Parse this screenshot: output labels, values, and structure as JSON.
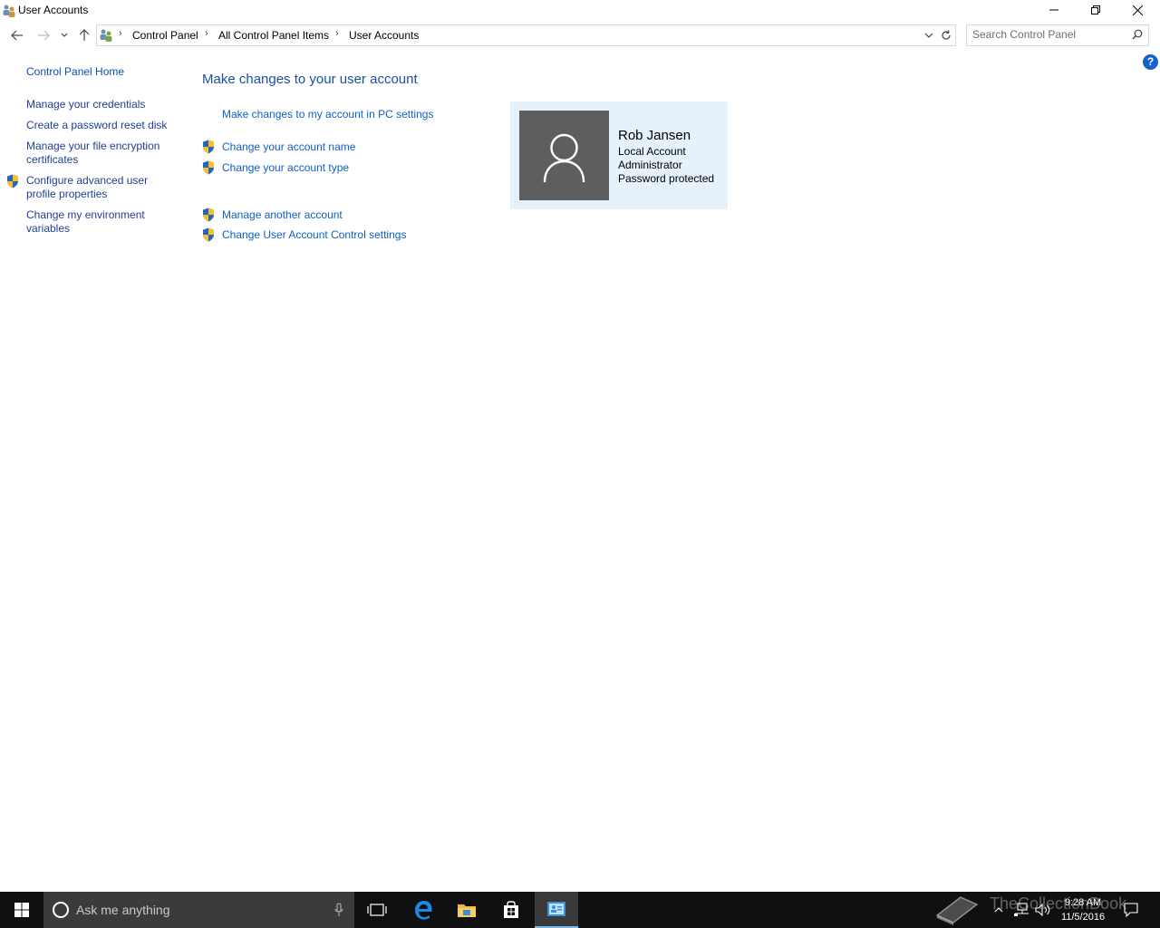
{
  "window": {
    "title": "User Accounts"
  },
  "nav": {
    "breadcrumbs": [
      "Control Panel",
      "All Control Panel Items",
      "User Accounts"
    ],
    "search_placeholder": "Search Control Panel"
  },
  "sidebar": {
    "home": "Control Panel Home",
    "items": [
      {
        "label_lines": [
          "Manage your credentials"
        ],
        "shield": false
      },
      {
        "label_lines": [
          "Create a password reset disk"
        ],
        "shield": false
      },
      {
        "label_lines": [
          "Manage your file encryption",
          "certificates"
        ],
        "shield": false
      },
      {
        "label_lines": [
          "Configure advanced user",
          "profile properties"
        ],
        "shield": true
      },
      {
        "label_lines": [
          "Change my environment",
          "variables"
        ],
        "shield": false
      }
    ]
  },
  "main": {
    "heading": "Make changes to your user account",
    "links": [
      {
        "label": "Make changes to my account in PC settings",
        "shield": false
      },
      {
        "label": "Change your account name",
        "shield": true
      },
      {
        "label": "Change your account type",
        "shield": true
      },
      {
        "label": "Manage another account",
        "shield": true
      },
      {
        "label": "Change User Account Control settings",
        "shield": true
      }
    ]
  },
  "user": {
    "name": "Rob Jansen",
    "account_type": "Local Account",
    "role": "Administrator",
    "password_status": "Password protected"
  },
  "taskbar": {
    "search_placeholder": "Ask me anything",
    "time": "9:28 AM",
    "date": "11/5/2016",
    "watermark": "TheCollectionBook"
  },
  "colors": {
    "link": "#0f5fc4",
    "heading": "#1e4fa1",
    "tile_bg": "#e5f1fb",
    "taskbar": "#101010"
  }
}
